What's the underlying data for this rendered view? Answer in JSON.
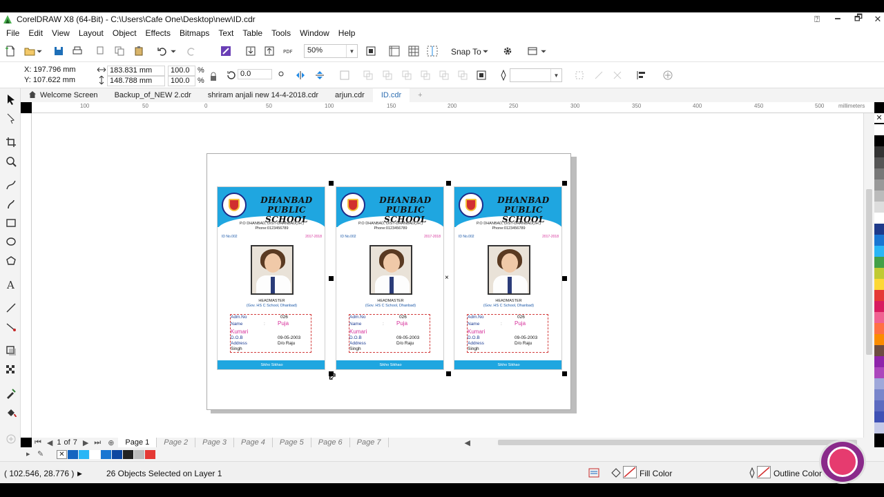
{
  "window": {
    "title": "CorelDRAW X8 (64-Bit) - C:\\Users\\Cafe One\\Desktop\\new\\ID.cdr",
    "controls": [
      "🗕",
      "🗗",
      "✕"
    ]
  },
  "menu": [
    "File",
    "Edit",
    "View",
    "Layout",
    "Object",
    "Effects",
    "Bitmaps",
    "Text",
    "Table",
    "Tools",
    "Window",
    "Help"
  ],
  "toolbar": {
    "zoom": "50%",
    "snap_to": "Snap To"
  },
  "propbar": {
    "x": "X: 197.796 mm",
    "y": "Y: 107.622 mm",
    "width": "183.831 mm",
    "height": "148.788 mm",
    "scale_w": "100.0",
    "scale_h": "100.0",
    "percent": "%",
    "rotation": "0.0"
  },
  "doc_tabs": [
    "Welcome Screen",
    "Backup_of_NEW 2.cdr",
    "shriram anjali new 14-4-2018.cdr",
    "arjun.cdr",
    "ID.cdr"
  ],
  "active_doc_tab": 4,
  "ruler": {
    "top_ticks": [
      "100",
      "50",
      "0",
      "50",
      "100",
      "150",
      "200",
      "250",
      "300",
      "350",
      "400",
      "450",
      "500"
    ],
    "unit": "millimeters"
  },
  "card": {
    "school_line1": "DHANBAD",
    "school_line2": "PUBLIC SCHOOL",
    "address": "P.O DHANBAD, DIST-DHANBAD(JH.)",
    "phone": "Phone:0123456789",
    "id_no": "ID No.002",
    "session": "2017-2018",
    "headmaster": "HEADMASTER",
    "headmaster_school": "(Gov. HS C School, Dhanbad)",
    "labels": [
      "Adm.No",
      "Name",
      "D.O.B",
      "Address"
    ],
    "adm_no": "026",
    "name_first": "Puja",
    "name_last": "Kumari",
    "dob": "09-05-2003",
    "address_val": "D/o Raju",
    "address_val2": "Singh",
    "colon": ":",
    "footer": "Sikho Sikhao"
  },
  "pages": {
    "counter_current": "1",
    "counter_of": "of",
    "counter_total": "7",
    "tabs": [
      "Page 1",
      "Page 2",
      "Page 3",
      "Page 4",
      "Page 5",
      "Page 6",
      "Page 7"
    ]
  },
  "status": {
    "coords": "( 102.546, 28.776 )",
    "selection": "26 Objects Selected on Layer 1",
    "fill": "Fill Color",
    "outline": "Outline Color"
  },
  "colors": {
    "accent_blue": "#1fa6e0",
    "details_border": "#d23a3a",
    "active_tab": "#2b6cb0"
  },
  "palette_colors": [
    "#ffffff",
    "#000000",
    "#333333",
    "#555555",
    "#777777",
    "#999999",
    "#bbbbbb",
    "#dddddd",
    "#ffffff",
    "#1e3a8a",
    "#1976d2",
    "#29b6f6",
    "#43a047",
    "#c0ca33",
    "#fdd835",
    "#e53935",
    "#d81b60",
    "#f06292",
    "#ff7043",
    "#fb8c00",
    "#6d4c41",
    "#8e24aa",
    "#ab47bc",
    "#9fa8da",
    "#7986cb",
    "#5c6bc0",
    "#3f51b5",
    "#c5cae9"
  ],
  "doc_palette_colors": [
    "#1565c0",
    "#29b6f6",
    "#ffffff",
    "#1976d2",
    "#0d47a1",
    "#222222",
    "#bdbdbd",
    "#e53935"
  ]
}
